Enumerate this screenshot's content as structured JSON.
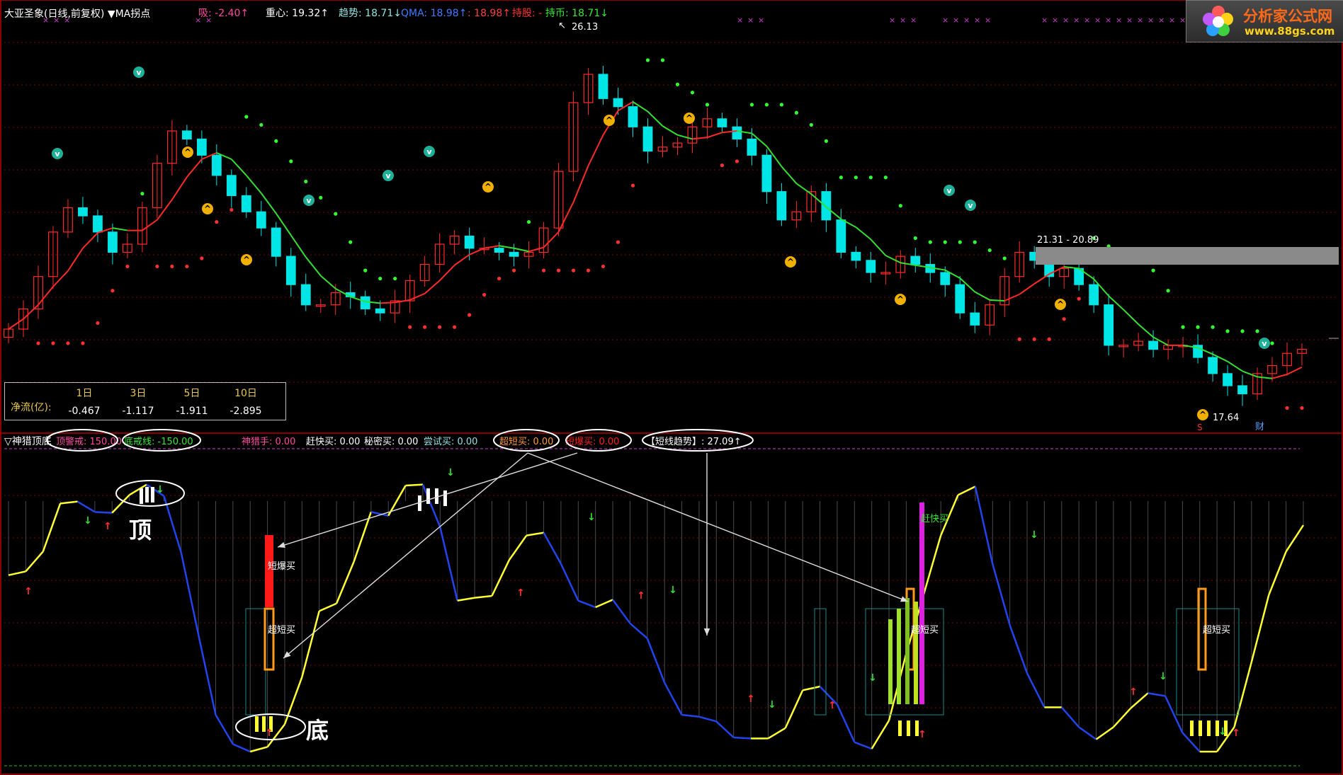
{
  "header": {
    "stock_name": "大亚圣象(日线,前复权)",
    "indicator_name": "▼MA拐点",
    "items": [
      {
        "label": "吸",
        "value": "-2.40",
        "arrow": "↑",
        "color": "#ff4aa0"
      },
      {
        "label": "重心",
        "value": "19.32",
        "arrow": "↑",
        "color": "#ffffff"
      },
      {
        "label": "趋势",
        "value": "18.71",
        "arrow": "↓",
        "color": "#8fe3e3"
      },
      {
        "label": "QMA",
        "value": "18.98",
        "arrow": "↑",
        "color": "#3f7bff"
      },
      {
        "label": "",
        "value": "18.98",
        "arrow": "↑",
        "color": "#ff4040"
      },
      {
        "label": "持股",
        "value": "-",
        "arrow": "",
        "color": "#ff3030"
      },
      {
        "label": "持币",
        "value": "18.71",
        "arrow": "↓",
        "color": "#36e836"
      }
    ]
  },
  "main_chart": {
    "high_label": "26.13",
    "low_label": "17.64",
    "box_label": "21.31 - 20.89",
    "marker_s": "S",
    "marker_cai": "财"
  },
  "net_flow": {
    "label": "净流(亿):",
    "headers": [
      "1日",
      "3日",
      "5日",
      "10日"
    ],
    "values": [
      "-0.467",
      "-1.117",
      "-1.911",
      "-2.895"
    ]
  },
  "sub_header": {
    "name": "▽神猎顶底",
    "items": [
      {
        "label": "顶警戒",
        "value": "150.00",
        "color": "#ff4aa0"
      },
      {
        "label": "底戒线",
        "value": "-150.00",
        "color": "#36e836"
      },
      {
        "label": "神猎手",
        "value": "0.00",
        "color": "#ff4aa0"
      },
      {
        "label": "赶快买",
        "value": "0.00",
        "color": "#ffffff"
      },
      {
        "label": "秘密买",
        "value": "0.00",
        "color": "#ffffff"
      },
      {
        "label": "尝试买",
        "value": "0.00",
        "color": "#8fe3e3"
      },
      {
        "label": "超短买",
        "value": "0.00",
        "color": "#ff9a30"
      },
      {
        "label": "短爆买",
        "value": "0.00",
        "color": "#ff2020"
      },
      {
        "label": "【短线趋势】",
        "value": "27.09",
        "arrow": "↑",
        "color": "#ffffff"
      }
    ]
  },
  "sub_chart": {
    "top_label": "顶",
    "bottom_label": "底",
    "duanbao_label": "短爆买",
    "chaoduan_label": "超短买",
    "ganjuai_label": "赶快买"
  },
  "logo": {
    "title": "分析家公式网",
    "url": "www.88gs.com"
  },
  "colors": {
    "up": "#ff2a2a",
    "down": "#00e5e5",
    "ma_red": "#ff2a2a",
    "ma_green": "#32e032",
    "oscillator_up": "#ffff33",
    "oscillator_down": "#2244ee",
    "grid": "#7a0000"
  },
  "chart_data": [
    {
      "type": "candlestick",
      "title": "大亚圣象(日线,前复权)",
      "price_range": [
        17.2,
        27.0
      ],
      "close_series": [
        19.3,
        19.8,
        20.6,
        21.7,
        22.3,
        22.1,
        21.7,
        21.2,
        21.4,
        22.3,
        23.4,
        24.2,
        24.0,
        23.6,
        23.1,
        22.6,
        22.2,
        21.8,
        21.1,
        20.4,
        19.9,
        19.9,
        20.2,
        20.1,
        19.8,
        19.7,
        20.0,
        20.5,
        20.9,
        21.4,
        21.6,
        21.3,
        21.3,
        21.2,
        21.1,
        21.2,
        21.8,
        23.2,
        24.9,
        25.6,
        25.0,
        24.8,
        24.3,
        23.7,
        23.8,
        23.9,
        24.3,
        24.5,
        24.3,
        24.0,
        23.6,
        22.7,
        22.0,
        22.2,
        22.7,
        22.0,
        21.2,
        21.0,
        20.7,
        20.7,
        21.1,
        20.9,
        20.7,
        20.4,
        19.7,
        19.4,
        19.9,
        20.6,
        21.2,
        21.0,
        20.6,
        20.8,
        20.4,
        19.9,
        18.9,
        18.9,
        19.0,
        18.8,
        18.9,
        18.9,
        18.6,
        18.2,
        17.9,
        17.7,
        18.2,
        18.4,
        18.7,
        18.8
      ],
      "annotations": [
        "26.13",
        "17.64",
        "21.31 - 20.89"
      ]
    },
    {
      "type": "line",
      "title": "▽神猎顶底",
      "y_range": [
        -150,
        150
      ],
      "series": [
        {
          "name": "【短线趋势】",
          "values": [
            37,
            41,
            62,
            113,
            115,
            104,
            103,
            122,
            133,
            121,
            61,
            -26,
            -111,
            -142,
            -150,
            -145,
            -121,
            -71,
            -1,
            7,
            51,
            104,
            100,
            132,
            133,
            88,
            10,
            13,
            15,
            53,
            79,
            82,
            49,
            10,
            3,
            11,
            -14,
            -30,
            -77,
            -111,
            -113,
            -118,
            -135,
            -136,
            -136,
            -125,
            -85,
            -81,
            -100,
            -140,
            -147,
            -117,
            -46,
            16,
            79,
            122,
            131,
            49,
            -16,
            -67,
            -103,
            -103,
            -124,
            -137,
            -124,
            -104,
            -88,
            -91,
            -130,
            -150,
            -150,
            -124,
            -55,
            16,
            62,
            90
          ]
        }
      ]
    }
  ]
}
